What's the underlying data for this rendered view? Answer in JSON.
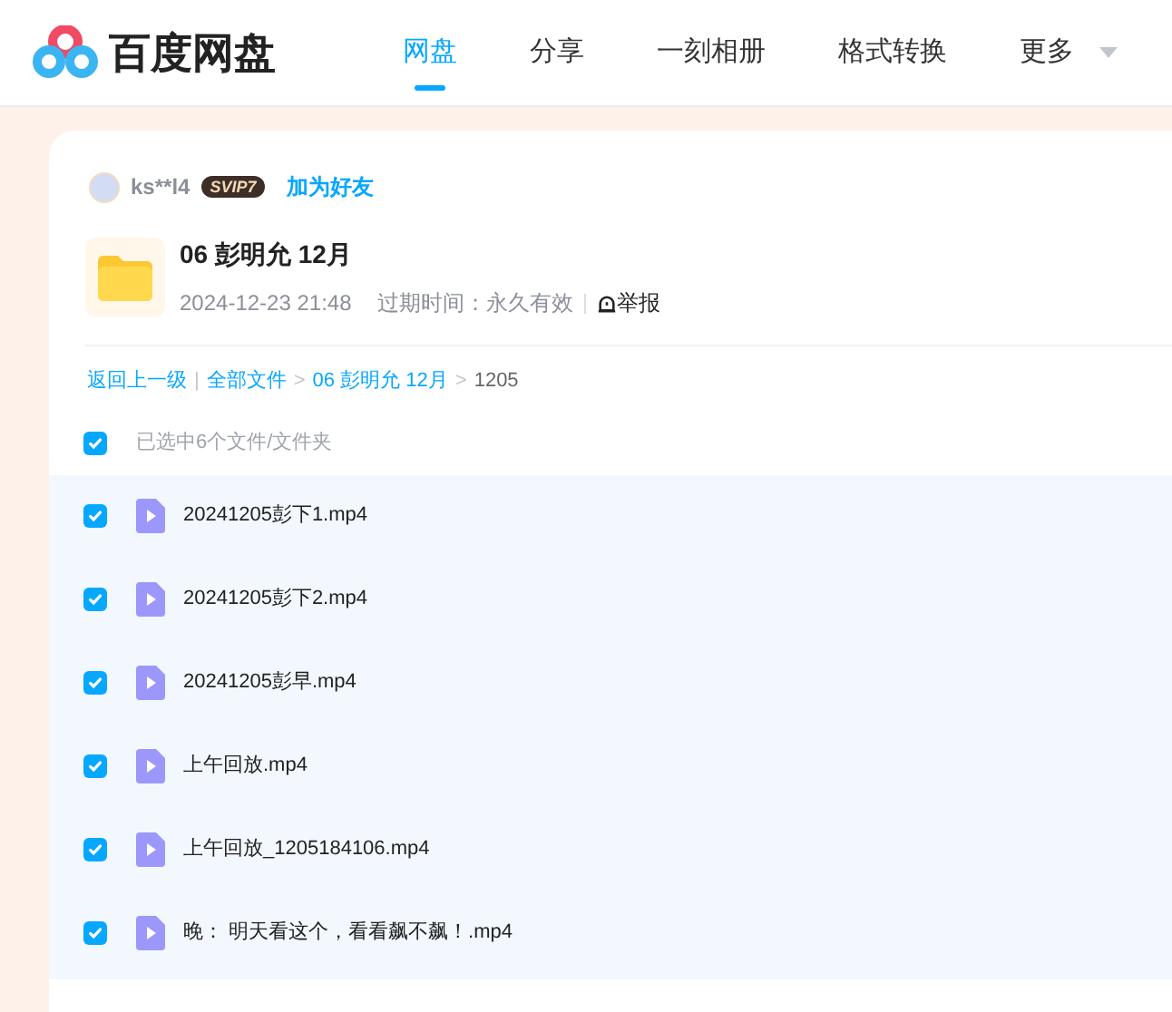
{
  "header": {
    "logo_text": "百度网盘",
    "tabs": [
      {
        "label": "网盘",
        "selected": true
      },
      {
        "label": "分享",
        "selected": false
      },
      {
        "label": "一刻相册",
        "selected": false
      },
      {
        "label": "格式转换",
        "selected": false
      },
      {
        "label": "更多",
        "selected": false,
        "dropdown": true
      }
    ]
  },
  "sharer": {
    "name": "ks**l4",
    "badge": "SVIP7",
    "add_friend": "加为好友"
  },
  "share": {
    "title": "06 彭明允 12月",
    "date": "2024-12-23 21:48",
    "expiry": "过期时间：永久有效",
    "report": "举报"
  },
  "breadcrumb": [
    {
      "label": "返回上一级",
      "kind": "link"
    },
    {
      "label": "|",
      "kind": "separator"
    },
    {
      "label": "全部文件",
      "kind": "link"
    },
    {
      "label": ">",
      "kind": "separator"
    },
    {
      "label": "06 彭明允 12月",
      "kind": "link"
    },
    {
      "label": ">",
      "kind": "separator"
    },
    {
      "label": "1205",
      "kind": "current"
    }
  ],
  "select_all": {
    "label": "已选中6个文件/文件夹",
    "checked": true
  },
  "files": [
    {
      "name": "20241205彭下1.mp4",
      "checked": true
    },
    {
      "name": "20241205彭下2.mp4",
      "checked": true
    },
    {
      "name": "20241205彭早.mp4",
      "checked": true
    },
    {
      "name": "上午回放.mp4",
      "checked": true
    },
    {
      "name": "上午回放_1205184106.mp4",
      "checked": true
    },
    {
      "name": "晚： 明天看这个，看看飙不飙！.mp4",
      "checked": true
    }
  ]
}
